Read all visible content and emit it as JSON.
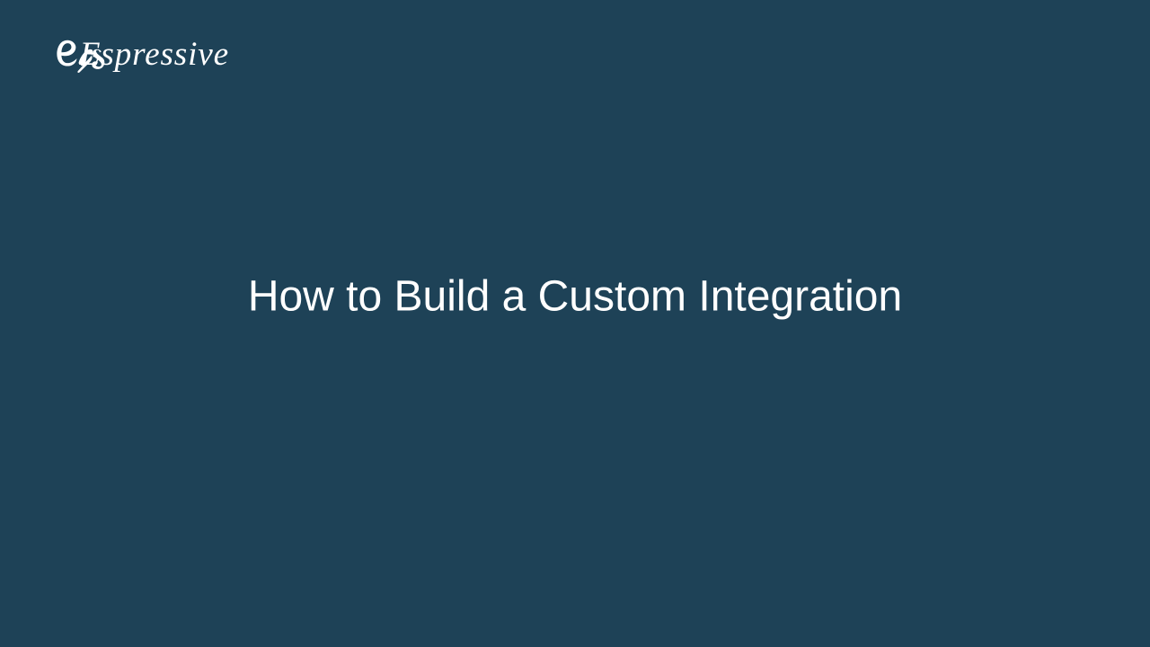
{
  "logo": {
    "text": "Espressive"
  },
  "main": {
    "title": "How to Build a Custom Integration"
  },
  "colors": {
    "background": "#1e4257",
    "text": "#ffffff"
  }
}
